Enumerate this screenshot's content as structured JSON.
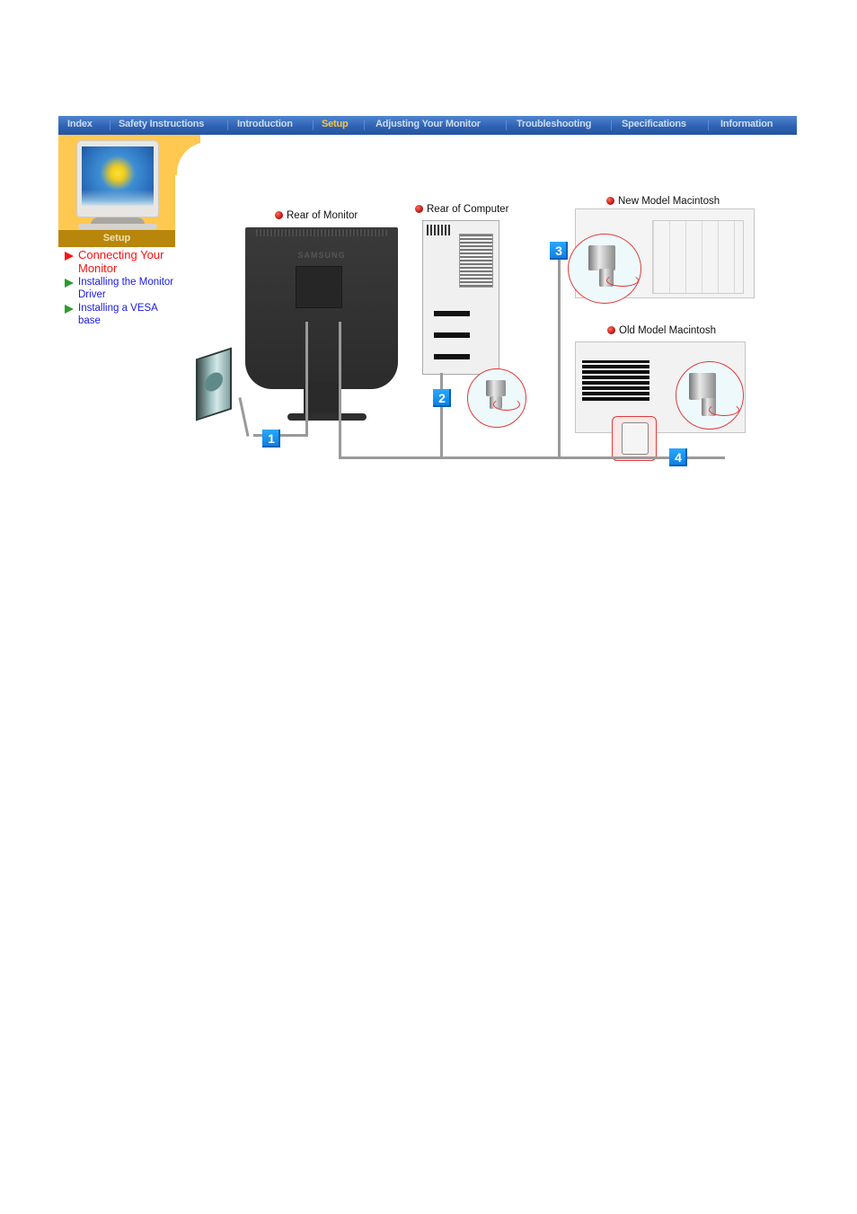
{
  "nav": {
    "items": [
      {
        "label": "Index",
        "active": false
      },
      {
        "label": "Safety Instructions",
        "active": false
      },
      {
        "label": "Introduction",
        "active": false
      },
      {
        "label": "Setup",
        "active": true
      },
      {
        "label": "Adjusting Your Monitor",
        "active": false
      },
      {
        "label": "Troubleshooting",
        "active": false
      },
      {
        "label": "Specifications",
        "active": false
      },
      {
        "label": "Information",
        "active": false
      }
    ]
  },
  "section": {
    "title": "Setup",
    "submenu": [
      {
        "label": "Connecting Your Monitor",
        "active": true
      },
      {
        "label": "Installing the Monitor Driver",
        "active": false
      },
      {
        "label": "Installing a VESA base",
        "active": false
      }
    ]
  },
  "diagram": {
    "labels": {
      "rear_monitor": "Rear of Monitor",
      "rear_computer": "Rear of Computer",
      "new_mac": "New Model Macintosh",
      "old_mac": "Old Model Macintosh"
    },
    "monitor_brand": "SAMSUNG",
    "steps": [
      "1",
      "2",
      "3",
      "4"
    ]
  },
  "colors": {
    "nav_bg": "#2f62b4",
    "nav_active": "#f5c542",
    "panel_yellow": "#ffc850",
    "setup_label_bg": "#b8860b",
    "submenu_active": "#ff1010",
    "submenu_link": "#1a1ae6",
    "step_badge": "#0a7de0"
  }
}
